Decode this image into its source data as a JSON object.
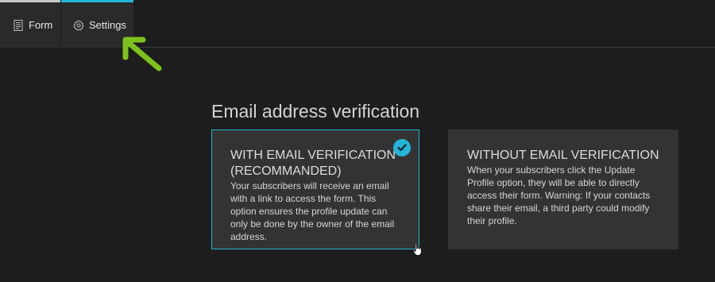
{
  "tabs": [
    {
      "label": "Form",
      "icon": "form-icon",
      "active": false
    },
    {
      "label": "Settings",
      "icon": "gear-icon",
      "active": true
    }
  ],
  "section": {
    "title": "Email address verification"
  },
  "options": [
    {
      "heading_line1": "WITH EMAIL VERIFICATION",
      "heading_line2": "(RECOMMANDED)",
      "description": "Your subscribers will receive an email with a link to access the form. This option ensures the profile update can only be done by the owner of the email address.",
      "selected": true
    },
    {
      "heading_line1": "WITHOUT EMAIL VERIFICATION",
      "description": "When your subscribers click the Update Profile option, they will be able to directly access their form. Warning: If your contacts share their email, a third party could modify their profile.",
      "selected": false
    }
  ],
  "colors": {
    "accent": "#23b4d8",
    "annotation_arrow": "#7cc21c",
    "background": "#1d1d1d",
    "card": "#333333"
  }
}
